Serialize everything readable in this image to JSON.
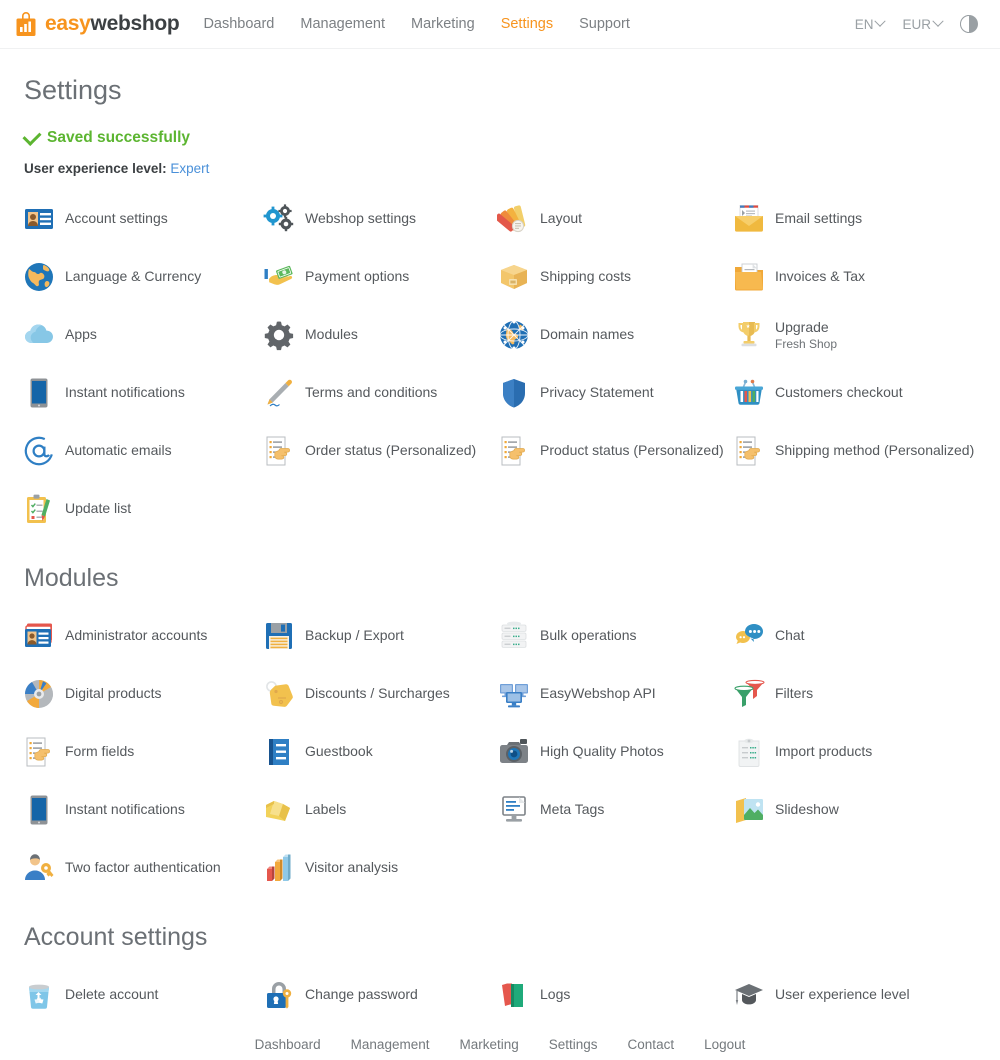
{
  "header": {
    "brand": {
      "easy": "easy",
      "webshop": "webshop",
      "logo_icon": "shopping-bag-chart-logo"
    },
    "nav": [
      {
        "label": "Dashboard",
        "active": false
      },
      {
        "label": "Management",
        "active": false
      },
      {
        "label": "Marketing",
        "active": false
      },
      {
        "label": "Settings",
        "active": true
      },
      {
        "label": "Support",
        "active": false
      }
    ],
    "language": "EN",
    "currency": "EUR",
    "theme_toggle_icon": "contrast-half-circle-icon"
  },
  "page": {
    "title": "Settings",
    "status_message": "Saved successfully",
    "status_color": "#5cb531",
    "ux_level_label": "User experience level:",
    "ux_level_value": "Expert",
    "ux_level_link_color": "#4a90d9"
  },
  "settings_tiles": [
    {
      "label": "Account settings",
      "icon": "id-card-icon"
    },
    {
      "label": "Webshop settings",
      "icon": "gears-icon"
    },
    {
      "label": "Layout",
      "icon": "color-fan-icon"
    },
    {
      "label": "Email settings",
      "icon": "open-envelope-icon"
    },
    {
      "label": "Language & Currency",
      "icon": "globe-icon"
    },
    {
      "label": "Payment options",
      "icon": "cash-hand-icon"
    },
    {
      "label": "Shipping costs",
      "icon": "box-icon"
    },
    {
      "label": "Invoices & Tax",
      "icon": "folder-document-icon"
    },
    {
      "label": "Apps",
      "icon": "cloud-icon"
    },
    {
      "label": "Modules",
      "icon": "gear-icon"
    },
    {
      "label": "Domain names",
      "icon": "network-globe-icon"
    },
    {
      "label": "Upgrade",
      "sublabel": "Fresh Shop",
      "icon": "trophy-icon"
    },
    {
      "label": "Instant notifications",
      "icon": "tablet-icon"
    },
    {
      "label": "Terms and conditions",
      "icon": "pen-signature-icon"
    },
    {
      "label": "Privacy Statement",
      "icon": "shield-icon"
    },
    {
      "label": "Customers checkout",
      "icon": "shopping-basket-icon"
    },
    {
      "label": "Automatic emails",
      "icon": "at-sign-icon"
    },
    {
      "label": "Order status (Personalized)",
      "icon": "form-hand-icon"
    },
    {
      "label": "Product status (Personalized)",
      "icon": "form-hand-icon"
    },
    {
      "label": "Shipping method (Personalized)",
      "icon": "form-hand-icon"
    },
    {
      "label": "Update list",
      "icon": "clipboard-checklist-icon"
    }
  ],
  "modules": {
    "title": "Modules",
    "tiles": [
      {
        "label": "Administrator accounts",
        "icon": "id-cards-stack-icon"
      },
      {
        "label": "Backup / Export",
        "icon": "floppy-disk-icon"
      },
      {
        "label": "Bulk operations",
        "icon": "server-stack-icon"
      },
      {
        "label": "Chat",
        "icon": "speech-bubbles-icon"
      },
      {
        "label": "Digital products",
        "icon": "cd-disc-icon"
      },
      {
        "label": "Discounts / Surcharges",
        "icon": "price-tag-icon"
      },
      {
        "label": "EasyWebshop API",
        "icon": "monitors-icon"
      },
      {
        "label": "Filters",
        "icon": "funnels-icon"
      },
      {
        "label": "Form fields",
        "icon": "form-hand-icon"
      },
      {
        "label": "Guestbook",
        "icon": "book-icon"
      },
      {
        "label": "High Quality Photos",
        "icon": "camera-icon"
      },
      {
        "label": "Import products",
        "icon": "import-tag-icon"
      },
      {
        "label": "Instant notifications",
        "icon": "tablet-icon"
      },
      {
        "label": "Labels",
        "icon": "labels-icon"
      },
      {
        "label": "Meta Tags",
        "icon": "monitor-text-icon"
      },
      {
        "label": "Slideshow",
        "icon": "slideshow-image-icon"
      },
      {
        "label": "Two factor authentication",
        "icon": "user-key-icon"
      },
      {
        "label": "Visitor analysis",
        "icon": "bar-chart-icon"
      }
    ]
  },
  "account_settings": {
    "title": "Account settings",
    "tiles": [
      {
        "label": "Delete account",
        "icon": "recycle-bin-icon"
      },
      {
        "label": "Change password",
        "icon": "lock-key-icon"
      },
      {
        "label": "Logs",
        "icon": "books-icon"
      },
      {
        "label": "User experience level",
        "icon": "graduation-cap-icon"
      }
    ]
  },
  "footer": {
    "links": [
      {
        "label": "Dashboard"
      },
      {
        "label": "Management"
      },
      {
        "label": "Marketing"
      },
      {
        "label": "Settings"
      },
      {
        "label": "Contact"
      },
      {
        "label": "Logout"
      }
    ]
  }
}
